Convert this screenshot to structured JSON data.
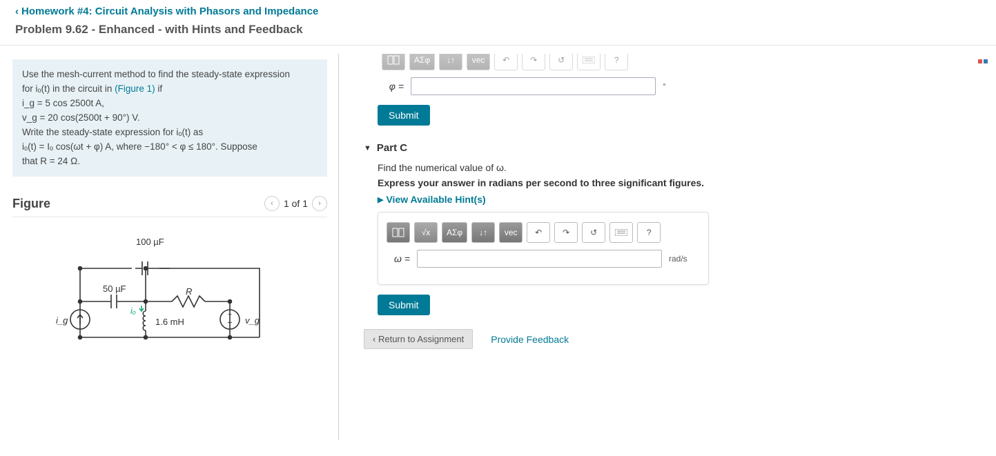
{
  "nav": {
    "breadcrumb": "Homework #4: Circuit Analysis with Phasors and Impedance"
  },
  "title": "Problem 9.62 - Enhanced - with Hints and Feedback",
  "problem": {
    "line1": "Use the mesh-current method to find the steady-state expression",
    "line2": "for iₒ(t) in the circuit in ",
    "figref": "(Figure 1)",
    "line2b": " if",
    "line3": "i_g = 5 cos 2500t  A,",
    "line4": "v_g = 20 cos(2500t + 90°) V.",
    "line5": "Write the steady-state expression for iₒ(t) as",
    "line6": "iₒ(t) = Iₒ cos(ωt + φ) A, where −180° < φ ≤ 180°. Suppose",
    "line7": "that R = 24 Ω."
  },
  "figure": {
    "heading": "Figure",
    "page": "1 of 1",
    "labels": {
      "c1": "100 µF",
      "c2": "50 µF",
      "r": "R",
      "l": "1.6 mH",
      "io": "iₒ",
      "ig": "i_g",
      "vg": "v_g"
    }
  },
  "partB": {
    "var": "φ =",
    "unit": "°",
    "submit": "Submit"
  },
  "partC": {
    "heading": "Part C",
    "instr": "Find the numerical value of ω.",
    "instr2": "Express your answer in radians per second to three significant figures.",
    "hints": "View Available Hint(s)",
    "var": "ω =",
    "unit": "rad/s",
    "submit": "Submit"
  },
  "toolbar": {
    "asf": "ΑΣφ",
    "vec": "vec",
    "q": "?"
  },
  "footer": {
    "return": "Return to Assignment",
    "feedback": "Provide Feedback"
  }
}
